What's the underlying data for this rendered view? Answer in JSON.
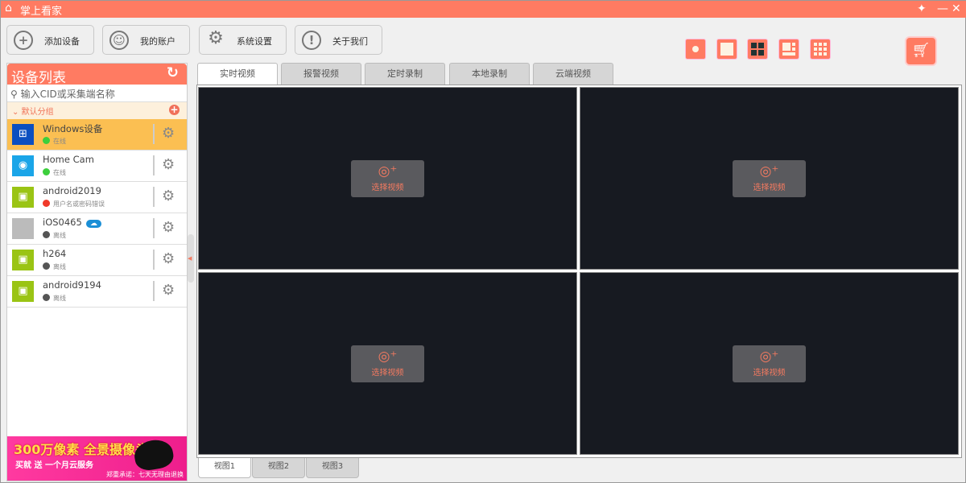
{
  "app": {
    "title": "掌上看家"
  },
  "toolbar": [
    {
      "label": "添加设备",
      "icon": "plus-circle-icon"
    },
    {
      "label": "我的账户",
      "icon": "user-icon"
    },
    {
      "label": "系统设置",
      "icon": "gear-icon"
    },
    {
      "label": "关于我们",
      "icon": "info-icon"
    }
  ],
  "sidebar": {
    "title": "设备列表",
    "search_placeholder": "输入CID或采集端名称",
    "group": "默认分组",
    "devices": [
      {
        "name": "Windows设备",
        "status": "在线",
        "status_color": "#3ccf3c",
        "icon_bg": "#0b4fc0",
        "icon": "⊞",
        "selected": true
      },
      {
        "name": "Home Cam",
        "status": "在线",
        "status_color": "#3ccf3c",
        "icon_bg": "#1aa5e8",
        "icon": "◉"
      },
      {
        "name": "android2019",
        "status": "用户名或密码错误",
        "status_color": "#f03a2a",
        "icon_bg": "#9ac414",
        "icon": "▣"
      },
      {
        "name": "iOS0465",
        "status": "离线",
        "status_color": "#555555",
        "icon_bg": "#bbbbbb",
        "icon": "",
        "cloud": "☁"
      },
      {
        "name": "h264",
        "status": "离线",
        "status_color": "#555555",
        "icon_bg": "#9ac414",
        "icon": "▣"
      },
      {
        "name": "android9194",
        "status": "离线",
        "status_color": "#555555",
        "icon_bg": "#9ac414",
        "icon": "▣"
      }
    ]
  },
  "ad": {
    "line1": "300万像素 全景摄像头",
    "line2": "买就 送 一个月云服务",
    "line3": "郑重承诺：七天无理由退换"
  },
  "tabs": [
    "实时视频",
    "报警视频",
    "定时录制",
    "本地录制",
    "云端视频"
  ],
  "video": {
    "select_label": "选择视频"
  },
  "view_tabs": [
    "视图1",
    "视图2",
    "视图3"
  ],
  "colors": {
    "accent": "#ff7b62",
    "selected": "#fbbf52"
  }
}
